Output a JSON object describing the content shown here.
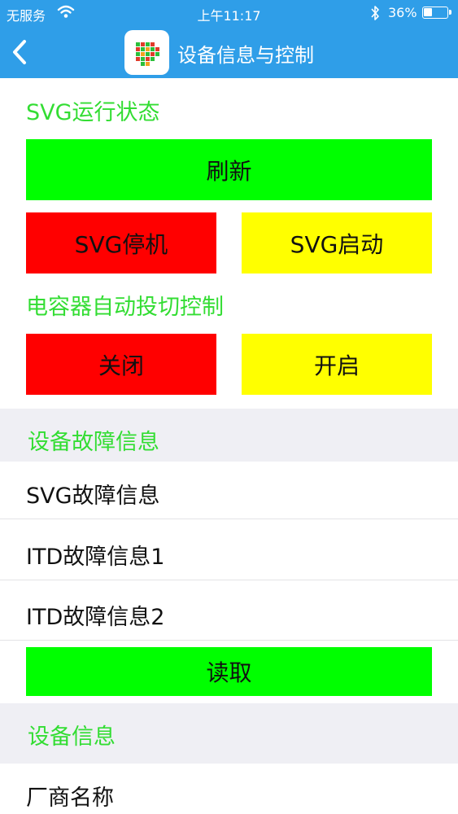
{
  "status_bar": {
    "carrier": "无服务",
    "time": "上午11:17",
    "battery": "36%",
    "battery_level": 0.36
  },
  "nav": {
    "title": "设备信息与控制"
  },
  "svg_status": {
    "label": "SVG运行状态",
    "refresh_label": "刷新",
    "stop_label": "SVG停机",
    "start_label": "SVG启动"
  },
  "capacitor": {
    "label": "电容器自动投切控制",
    "off_label": "关闭",
    "on_label": "开启"
  },
  "fault_info": {
    "header": "设备故障信息",
    "items": [
      "SVG故障信息",
      "ITD故障信息1",
      "ITD故障信息2"
    ],
    "read_label": "读取"
  },
  "device_info": {
    "header": "设备信息",
    "items": [
      "厂商名称"
    ]
  },
  "colors": {
    "nav_bg": "#2f9ee8",
    "accent_green_text": "#33dd33",
    "button_green": "#00ff00",
    "button_red": "#ff0000",
    "button_yellow": "#ffff00",
    "group_bg": "#efeff4"
  }
}
